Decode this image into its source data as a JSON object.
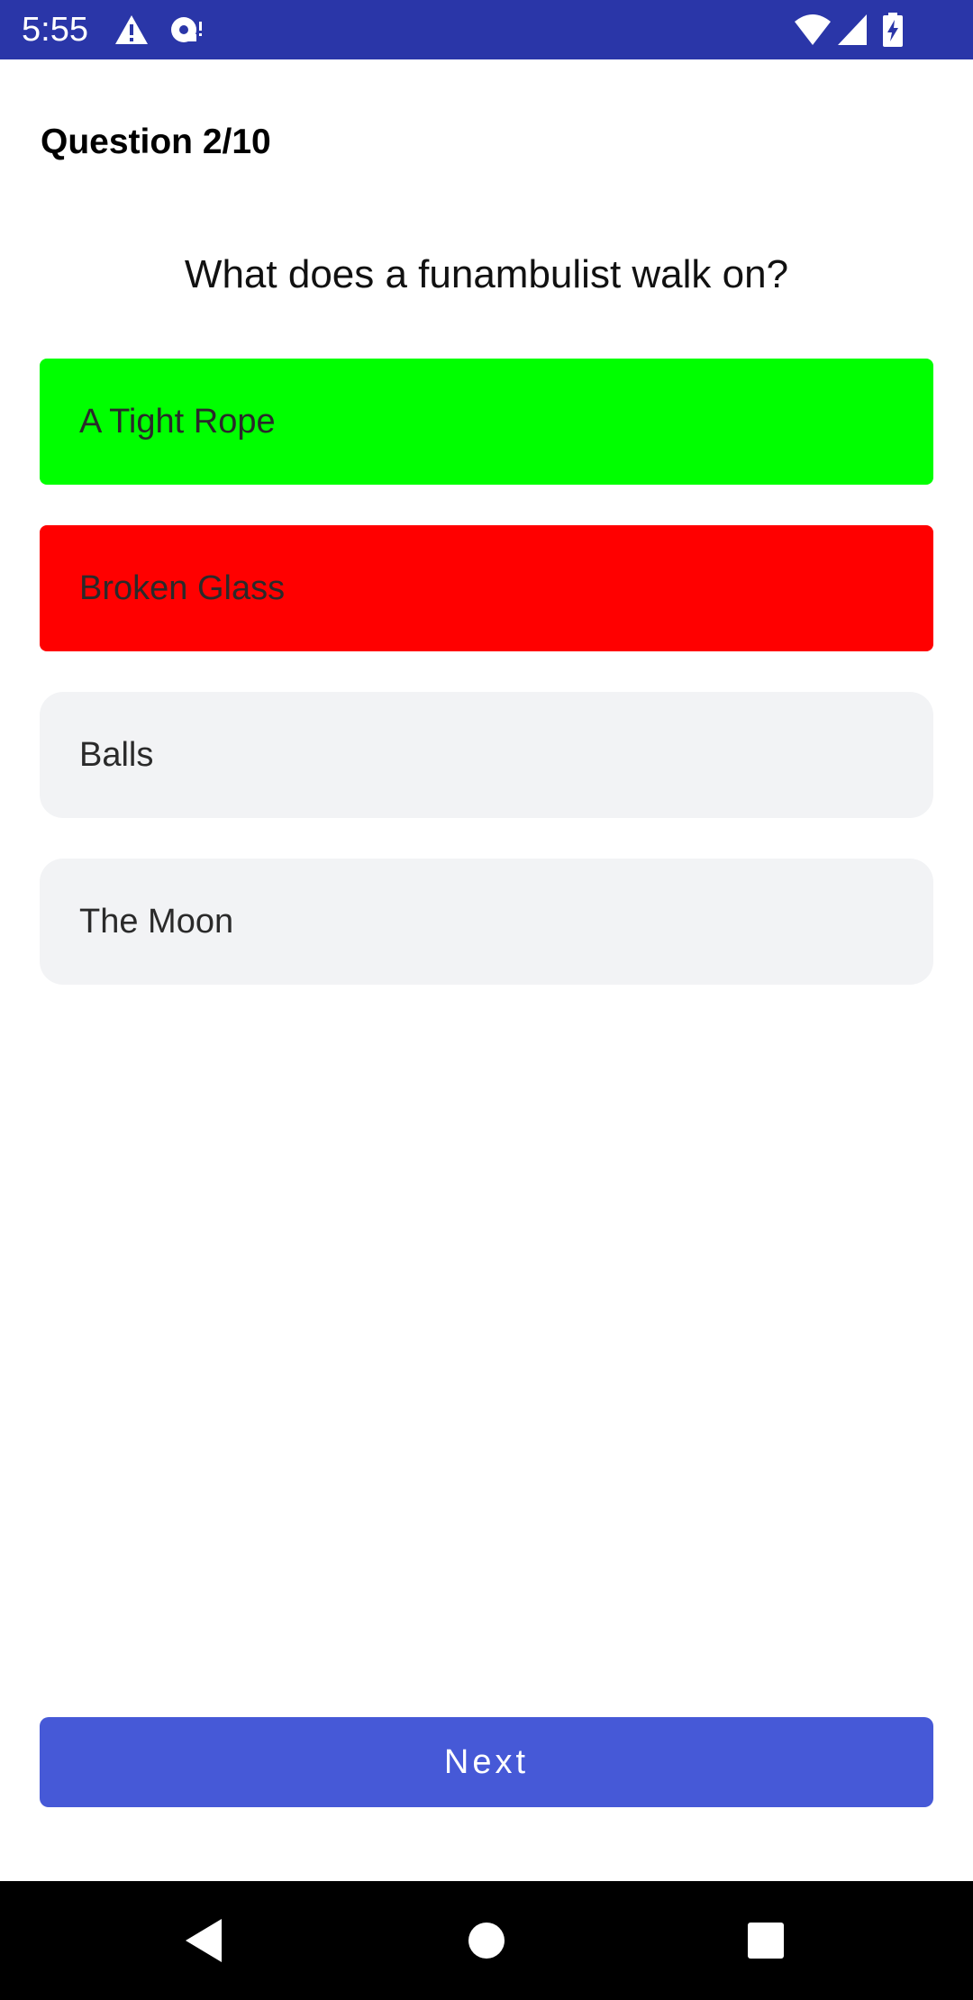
{
  "status_bar": {
    "time": "5:55",
    "background": "#2a36a8",
    "icons_left": [
      "warning-icon",
      "media-icon"
    ],
    "icons_right": [
      "wifi-icon",
      "cell-signal-icon",
      "battery-charging-icon"
    ]
  },
  "quiz": {
    "counter": "Question 2/10",
    "question": "What does a funambulist walk on?",
    "options": [
      {
        "label": "A Tight Rope",
        "state": "correct",
        "color": "#00ff00"
      },
      {
        "label": "Broken Glass",
        "state": "wrong",
        "color": "#ff0000"
      },
      {
        "label": "Balls",
        "state": "neutral",
        "color": "#f2f3f5"
      },
      {
        "label": "The Moon",
        "state": "neutral",
        "color": "#f2f3f5"
      }
    ],
    "next_label": "Next",
    "next_color": "#4659d7"
  },
  "nav_bar": {
    "buttons": [
      "back-icon",
      "home-icon",
      "recents-icon"
    ]
  }
}
